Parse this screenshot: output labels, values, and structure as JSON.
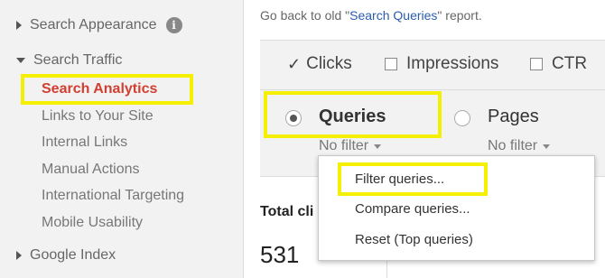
{
  "sidebar": {
    "search_appearance": "Search Appearance",
    "search_traffic": "Search Traffic",
    "items": [
      {
        "label": "Search Analytics"
      },
      {
        "label": "Links to Your Site"
      },
      {
        "label": "Internal Links"
      },
      {
        "label": "Manual Actions"
      },
      {
        "label": "International Targeting"
      },
      {
        "label": "Mobile Usability"
      }
    ],
    "google_index": "Google Index"
  },
  "header": {
    "back_prefix": "Go back to old \"",
    "back_link": "Search Queries",
    "back_suffix": "\" report."
  },
  "metrics": {
    "clicks": "Clicks",
    "impressions": "Impressions",
    "ctr": "CTR"
  },
  "dimensions": {
    "queries": "Queries",
    "pages": "Pages",
    "queries_filter": "No filter",
    "pages_filter": "No filter"
  },
  "menu": {
    "filter": "Filter queries...",
    "compare": "Compare queries...",
    "reset": "Reset (Top queries)"
  },
  "totals": {
    "label": "Total cli",
    "value": "531"
  }
}
